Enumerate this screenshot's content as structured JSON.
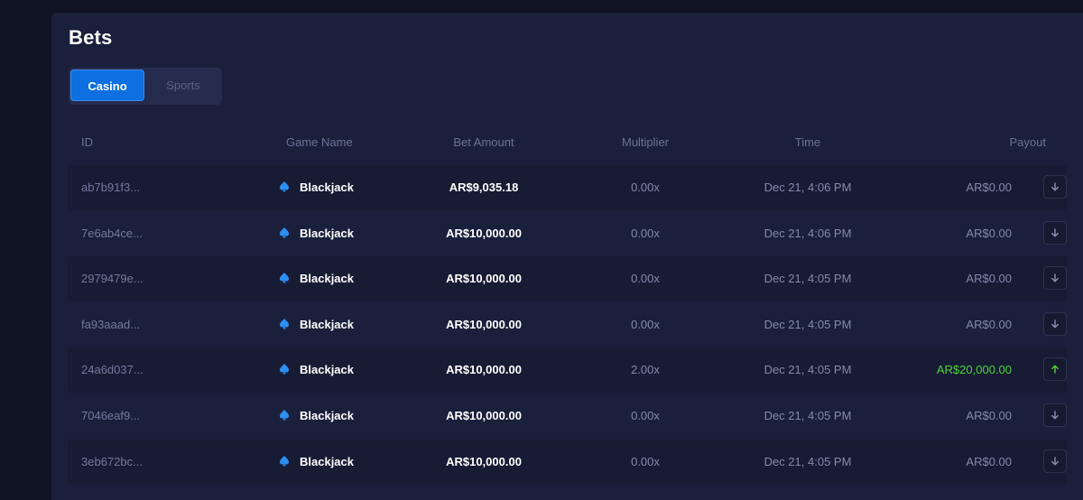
{
  "header": {
    "title": "Bets"
  },
  "tabs": [
    {
      "label": "Casino",
      "active": true
    },
    {
      "label": "Sports",
      "active": false
    }
  ],
  "table": {
    "columns": [
      "ID",
      "Game Name",
      "Bet Amount",
      "Multiplier",
      "Time",
      "Payout"
    ],
    "rows": [
      {
        "id": "ab7b91f3...",
        "game": "Blackjack",
        "amount": "AR$9,035.18",
        "multiplier": "0.00x",
        "time": "Dec 21, 4:06 PM",
        "payout": "AR$0.00",
        "direction": "down"
      },
      {
        "id": "7e6ab4ce...",
        "game": "Blackjack",
        "amount": "AR$10,000.00",
        "multiplier": "0.00x",
        "time": "Dec 21, 4:06 PM",
        "payout": "AR$0.00",
        "direction": "down"
      },
      {
        "id": "2979479e...",
        "game": "Blackjack",
        "amount": "AR$10,000.00",
        "multiplier": "0.00x",
        "time": "Dec 21, 4:05 PM",
        "payout": "AR$0.00",
        "direction": "down"
      },
      {
        "id": "fa93aaad...",
        "game": "Blackjack",
        "amount": "AR$10,000.00",
        "multiplier": "0.00x",
        "time": "Dec 21, 4:05 PM",
        "payout": "AR$0.00",
        "direction": "down"
      },
      {
        "id": "24a6d037...",
        "game": "Blackjack",
        "amount": "AR$10,000.00",
        "multiplier": "2.00x",
        "time": "Dec 21, 4:05 PM",
        "payout": "AR$20,000.00",
        "direction": "up"
      },
      {
        "id": "7046eaf9...",
        "game": "Blackjack",
        "amount": "AR$10,000.00",
        "multiplier": "0.00x",
        "time": "Dec 21, 4:05 PM",
        "payout": "AR$0.00",
        "direction": "down"
      },
      {
        "id": "3eb672bc...",
        "game": "Blackjack",
        "amount": "AR$10,000.00",
        "multiplier": "0.00x",
        "time": "Dec 21, 4:05 PM",
        "payout": "AR$0.00",
        "direction": "down"
      }
    ]
  },
  "icons": {
    "game": "spade-icon",
    "down": "arrow-down-icon",
    "up": "arrow-up-icon"
  },
  "colors": {
    "accent": "#0d6fe0",
    "win": "#4fd23c",
    "spade": "#2e8ff2",
    "arrow_down": "#8a91b3",
    "arrow_up": "#4fd23c"
  }
}
